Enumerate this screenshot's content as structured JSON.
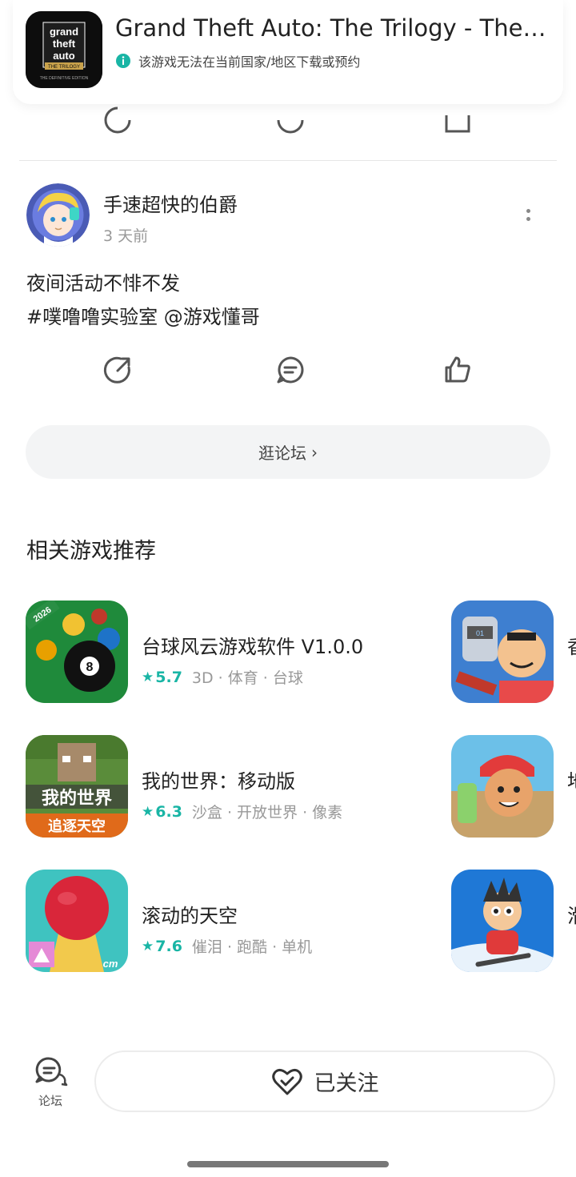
{
  "header": {
    "title": "Grand Theft Auto: The Trilogy - The D...",
    "notice": "该游戏无法在当前国家/地区下载或预约",
    "icon": {
      "name": "gta-trilogy-app-icon",
      "logo_lines": [
        "grand",
        "theft",
        "auto"
      ],
      "badge": "THE TRILOGY",
      "sub": "THE DEFINITIVE EDITION"
    }
  },
  "post": {
    "username": "手速超快的伯爵",
    "time": "3 天前",
    "lines": [
      "夜间活动不悱不发",
      "#噗噜噜实验室 @游戏懂哥"
    ]
  },
  "forum_link": {
    "label": "逛论坛",
    "chevron": "›"
  },
  "section_title": "相关游戏推荐",
  "games": [
    {
      "name": "台球风云游戏软件 V1.0.0",
      "rating": "5.7",
      "tags": "3D · 体育 · 台球",
      "icon": "billiards-icon",
      "badge": "2026"
    },
    {
      "name": "我的世界：移动版",
      "rating": "6.3",
      "tags": "沙盒 · 开放世界 · 像素",
      "icon": "minecraft-icon",
      "logo": "我的世界",
      "banner": "追逐天空"
    },
    {
      "name": "滚动的天空",
      "rating": "7.6",
      "tags": "催泪 · 跑酷 · 单机",
      "icon": "rolling-sky-icon",
      "brand": "cm"
    },
    {
      "name": "香",
      "rating": "",
      "tags": "",
      "icon": "cartoon-brawl-icon",
      "badge": "01"
    },
    {
      "name": "地",
      "rating": "",
      "tags": "",
      "icon": "subway-surfers-icon"
    },
    {
      "name": "滑",
      "rating": "",
      "tags": "",
      "icon": "ski-safari-icon"
    }
  ],
  "bottom": {
    "forum_label": "论坛",
    "follow_label": "已关注"
  },
  "colors": {
    "accent": "#19b5a5",
    "divider": "#e6e6e6",
    "button_bg": "#f3f4f5"
  }
}
